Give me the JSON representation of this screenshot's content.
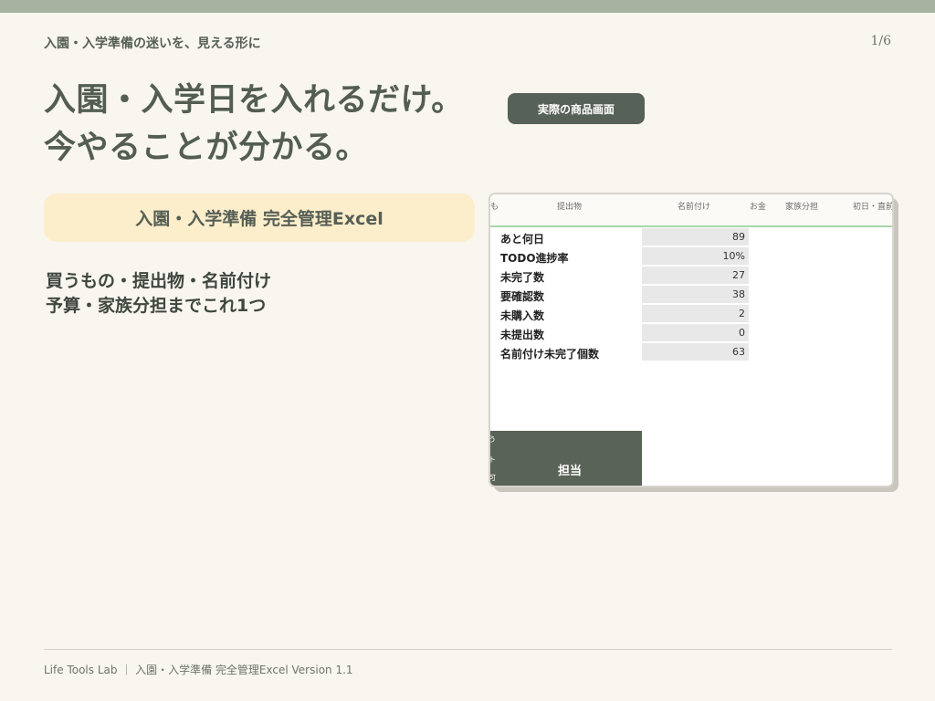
{
  "header": {
    "eyebrow": "入園・入学準備の迷いを、見える形に",
    "page_indicator": "1/6"
  },
  "headline": {
    "line1": "入園・入学日を入れるだけ。",
    "line2": "今やることが分かる。"
  },
  "badge_label": "実際の商品画面",
  "product_name": "入園・入学準備 完全管理Excel",
  "description": {
    "line1": "買うもの・提出物・名前付け",
    "line2": "予算・家族分担までこれ1つ"
  },
  "screenshot": {
    "columns": [
      "も",
      "提出物",
      "名前付け",
      "お金",
      "家族分担",
      "初日・直前"
    ],
    "kpis": [
      {
        "label": "あと何日",
        "value": "89"
      },
      {
        "label": "TODO進捗率",
        "value": "10%"
      },
      {
        "label": "未完了数",
        "value": "27"
      },
      {
        "label": "要確認数",
        "value": "38"
      },
      {
        "label": "未購入数",
        "value": "2"
      },
      {
        "label": "未提出数",
        "value": "0"
      },
      {
        "label": "名前付け未完了個数",
        "value": "63"
      }
    ],
    "assign_label": "担当",
    "side_chars": [
      "う",
      "ト",
      "可"
    ]
  },
  "footer": {
    "text": "Life Tools Lab ｜ 入園・入学準備 完全管理Excel  Version 1.1"
  },
  "colors": {
    "accent": "#566157",
    "band": "#a7b3a0",
    "pill": "#fdeecb",
    "background": "#f9f6f0",
    "header_rule": "#a8d6ae"
  }
}
